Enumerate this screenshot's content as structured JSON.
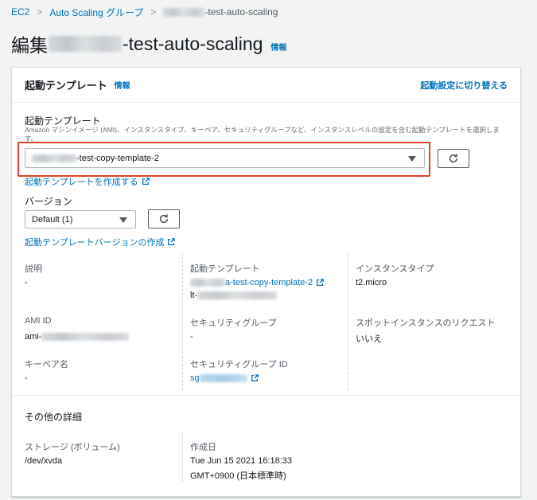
{
  "breadcrumb": {
    "ec2": "EC2",
    "asg": "Auto Scaling グループ",
    "current_suffix": "-test-auto-scaling"
  },
  "page": {
    "title_prefix": "編集",
    "title_suffix": "-test-auto-scaling",
    "info": "情報"
  },
  "panel": {
    "title": "起動テンプレート",
    "info": "情報",
    "switch_label": "起動設定に切り替える"
  },
  "launch_template": {
    "label": "起動テンプレート",
    "description": "Amazon マシンイメージ (AMI)、インスタンスタイプ、キーペア、セキュリティグループなど、インスタンスレベルの設定を含む起動テンプレートを選択します。",
    "selected_suffix": "-test-copy-template-2",
    "create_link": "起動テンプレートを作成する"
  },
  "version": {
    "label": "バージョン",
    "selected": "Default (1)",
    "create_link": "起動テンプレートバージョンの作成"
  },
  "details": {
    "description_label": "説明",
    "description_value": "-",
    "template_label": "起動テンプレート",
    "template_link_suffix": "a-test-copy-template-2",
    "template_id_prefix": "lt-",
    "instance_type_label": "インスタンスタイプ",
    "instance_type_value": "t2.micro",
    "ami_label": "AMI ID",
    "ami_prefix": "ami-",
    "sg_label": "セキュリティグループ",
    "sg_value": "-",
    "spot_label": "スポットインスタンスのリクエスト",
    "spot_value": "いいえ",
    "keypair_label": "キーペア名",
    "keypair_value": "-",
    "sg_id_label": "セキュリティグループ ID",
    "sg_id_prefix": "sg"
  },
  "other": {
    "title": "その他の詳細",
    "storage_label": "ストレージ (ボリューム)",
    "storage_value": "/dev/xvda",
    "created_label": "作成日",
    "created_line1": "Tue Jun 15 2021 16:18:33",
    "created_line2": "GMT+0900 (日本標準時)"
  },
  "colors": {
    "link": "#0073bb",
    "highlight": "#e0412b",
    "background": "#f2f3f3"
  }
}
